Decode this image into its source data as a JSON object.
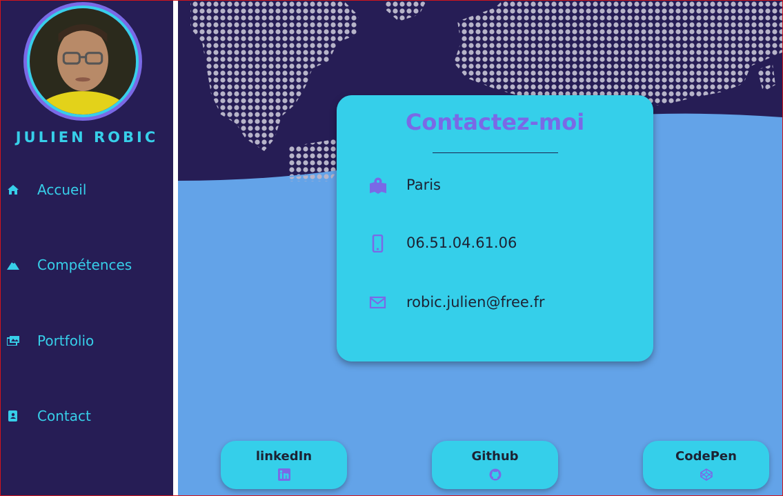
{
  "profile": {
    "name": "JULIEN ROBIC"
  },
  "nav": {
    "items": [
      {
        "label": "Accueil",
        "icon": "home-icon"
      },
      {
        "label": "Compétences",
        "icon": "mountain-icon"
      },
      {
        "label": "Portfolio",
        "icon": "images-icon"
      },
      {
        "label": "Contact",
        "icon": "address-book-icon"
      }
    ]
  },
  "contact": {
    "title": "Contactez-moi",
    "rows": [
      {
        "icon": "map-icon",
        "text": "Paris"
      },
      {
        "icon": "mobile-phone-icon",
        "text": "06.51.04.61.06"
      },
      {
        "icon": "envelope-icon",
        "text": "robic.julien@free.fr"
      }
    ]
  },
  "social": [
    {
      "label": "linkedIn",
      "icon": "linkedin-icon"
    },
    {
      "label": "Github",
      "icon": "github-icon"
    },
    {
      "label": "CodePen",
      "icon": "codepen-icon"
    }
  ],
  "colors": {
    "sidebar": "#261d55",
    "accent_cyan": "#37cfe9",
    "accent_purple": "#7a69e6",
    "main_bg": "#63a3e8",
    "card": "#35cfea"
  }
}
